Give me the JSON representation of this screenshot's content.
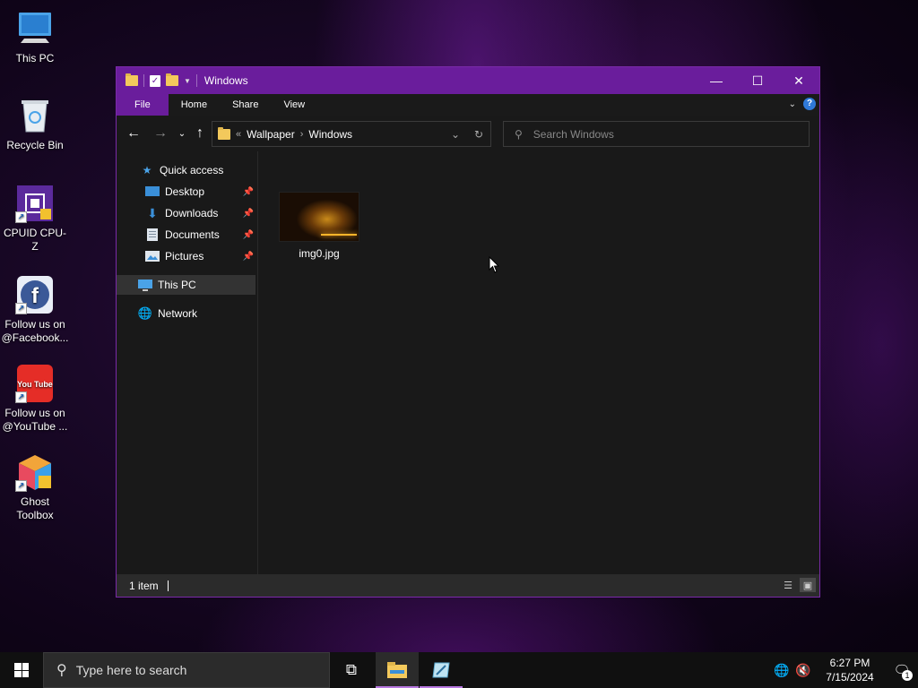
{
  "desktop": {
    "icons": [
      {
        "label": "This PC",
        "icon": "monitor-icon"
      },
      {
        "label": "Recycle Bin",
        "icon": "recycle-bin-icon"
      },
      {
        "label": "CPUID CPU-Z",
        "icon": "cpu-chip-icon"
      },
      {
        "label": "Follow us on @Facebook...",
        "icon": "facebook-icon"
      },
      {
        "label": "Follow us on @YouTube ...",
        "icon": "youtube-icon"
      },
      {
        "label": "Ghost Toolbox",
        "icon": "cube-icon"
      }
    ],
    "youtube_glyph": "You Tube",
    "facebook_glyph": "f"
  },
  "window": {
    "title": "Windows",
    "ribbon_tabs": [
      "File",
      "Home",
      "Share",
      "View"
    ],
    "help": "?",
    "address": {
      "overflow": "«",
      "crumbs": [
        "Wallpaper",
        "Windows"
      ]
    },
    "search_placeholder": "Search Windows",
    "nav_pane": {
      "quick_access": "Quick access",
      "pinned": [
        "Desktop",
        "Downloads",
        "Documents",
        "Pictures"
      ],
      "this_pc": "This PC",
      "network": "Network"
    },
    "files": [
      {
        "name": "img0.jpg"
      }
    ],
    "status": "1 item",
    "accent_color": "#6a1d9c"
  },
  "taskbar": {
    "search_placeholder": "Type here to search",
    "clock": {
      "time": "6:27 PM",
      "date": "7/15/2024"
    },
    "notification_count": "1"
  }
}
